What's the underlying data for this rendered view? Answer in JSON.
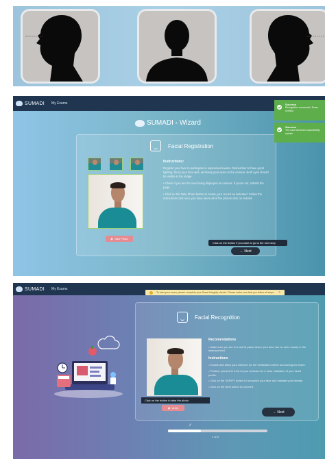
{
  "panel1": {
    "silhouettes": [
      "profile-left-icon",
      "frontal-face-icon",
      "profile-right-icon"
    ],
    "card_color": "#c6c3c1",
    "background_color": "#a9d0e6"
  },
  "panel2": {
    "brand": "SUMADI",
    "nav_my_exams": "My Exams",
    "wizard_brand": "SUMADI",
    "wizard_word": "Wizard",
    "card_title": "Facial Registration",
    "instructions_title": "Instructions:",
    "instruction_1": "Register your face to participate in supervised exams. Remember to have good lighting, focus your face well, and keep your eyes on the camera. Both eyes should be visible in the image.",
    "instruction_2": "• Check if you are the user being displayed on camera. If you're not, refresh the page.",
    "instruction_3": "• Click on the Take Photo button to create your record as indicated. Follow the instructions and once you have taken all of the photos click on Submit.",
    "take_photo": "Take Photo",
    "tooltip": "Click on the button if you want to go to the next step",
    "next": "Next",
    "toasts": [
      {
        "title": "Success",
        "message": "Recognition successful. Exam verified"
      },
      {
        "title": "Success",
        "message": "The user has been successfully update"
      }
    ],
    "success_color": "#5eae4c"
  },
  "panel3": {
    "brand": "SUMADI",
    "nav_my_exams": "My Exams",
    "banner": "To start your exam, please complete your Smart Integrity checks. Please make sure that you follow all steps.",
    "card_title": "Facial Recognition",
    "recommendations_title": "Recomendations",
    "recommendation_1": "• Make sure you are in a well-lit place where your face can be seen clearly in the webcam feed.",
    "instructions_title": "Instructions",
    "steps": [
      "• Enable and allow your webcam for the verification before and during the exam.",
      "• Position yourself in front of your webcam for a clear validation of your facial profile.",
      "• Click on the VERIFY button to recognize your face and validate your identity.",
      "• Click on the Next button to proceed."
    ],
    "tooltip": "Click on the button to take the photo",
    "verify": "Verify",
    "next": "Next",
    "pager": "1 of 3",
    "progress": 0.33
  }
}
